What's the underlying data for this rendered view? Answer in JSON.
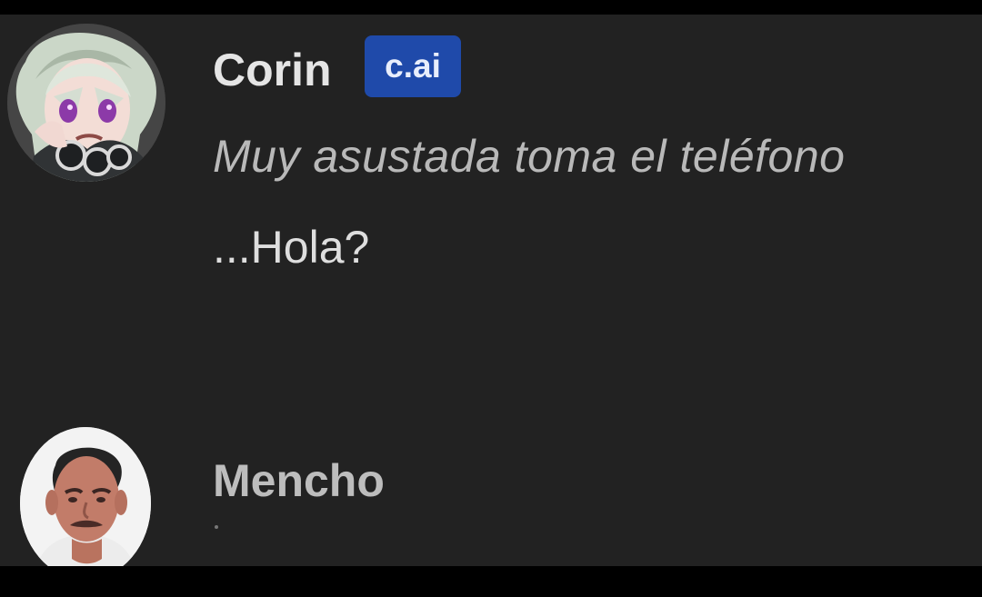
{
  "conversation": {
    "messages": [
      {
        "author": "Corin",
        "badge": "c.ai",
        "avatar": "corin-anime-avatar",
        "action": "Muy asustada toma el teléfono",
        "text": "...Hola?"
      },
      {
        "author": "Mencho",
        "avatar": "mencho-photo-avatar"
      }
    ]
  },
  "colors": {
    "background": "#222222",
    "frame": "#000000",
    "badge": "#1f4aaa",
    "name_primary": "#e5e5e5",
    "name_secondary": "#bdbdbd",
    "action_text": "#b9b9b9",
    "message_text": "#dedede"
  }
}
